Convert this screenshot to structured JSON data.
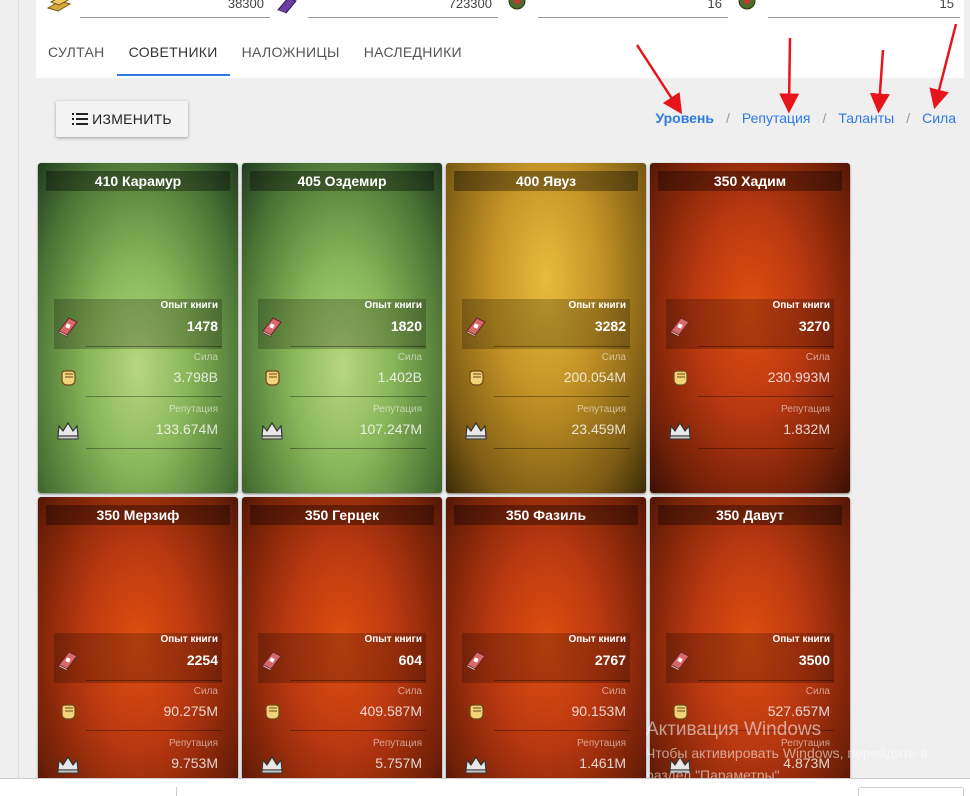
{
  "resources": [
    {
      "name": "gold-icon",
      "value": "38300"
    },
    {
      "name": "book-icon",
      "value": "723300"
    },
    {
      "name": "wreath-icon",
      "value": "16"
    },
    {
      "name": "wreath-icon-2",
      "value": "15"
    }
  ],
  "tabs": [
    {
      "label": "СУЛТАН",
      "active": false
    },
    {
      "label": "СОВЕТНИКИ",
      "active": true
    },
    {
      "label": "НАЛОЖНИЦЫ",
      "active": false
    },
    {
      "label": "НАСЛЕДНИКИ",
      "active": false
    }
  ],
  "toolbar": {
    "edit_label": "ИЗМЕНИТЬ"
  },
  "sort": {
    "options": [
      "Уровень",
      "Репутация",
      "Таланты",
      "Сила"
    ],
    "active": "Уровень",
    "separator": "/"
  },
  "stat_labels": {
    "book": "Опыт книги",
    "power": "Сила",
    "reputation": "Репутация"
  },
  "advisors": [
    {
      "title": "410 Карамур",
      "theme": "green",
      "book": "1478",
      "power": "3.798B",
      "reputation": "133.674M"
    },
    {
      "title": "405 Оздемир",
      "theme": "green",
      "book": "1820",
      "power": "1.402B",
      "reputation": "107.247M"
    },
    {
      "title": "400 Явуз",
      "theme": "gold",
      "book": "3282",
      "power": "200.054M",
      "reputation": "23.459M"
    },
    {
      "title": "350 Хадим",
      "theme": "red",
      "book": "3270",
      "power": "230.993M",
      "reputation": "1.832M"
    },
    {
      "title": "350 Мерзиф",
      "theme": "red",
      "book": "2254",
      "power": "90.275M",
      "reputation": "9.753M"
    },
    {
      "title": "350 Герцек",
      "theme": "red",
      "book": "604",
      "power": "409.587M",
      "reputation": "5.757M"
    },
    {
      "title": "350 Фазиль",
      "theme": "red",
      "book": "2767",
      "power": "90.153M",
      "reputation": "1.461M"
    },
    {
      "title": "350 Давут",
      "theme": "red",
      "book": "3500",
      "power": "527.657M",
      "reputation": "4.873M"
    }
  ],
  "watermark": {
    "title": "Активация Windows",
    "line1": "Чтобы активировать Windows, перейдите в",
    "line2": "раздел \"Параметры\"."
  },
  "colors": {
    "accent": "#2d7be0",
    "annotation_arrow": "#e8141b"
  }
}
